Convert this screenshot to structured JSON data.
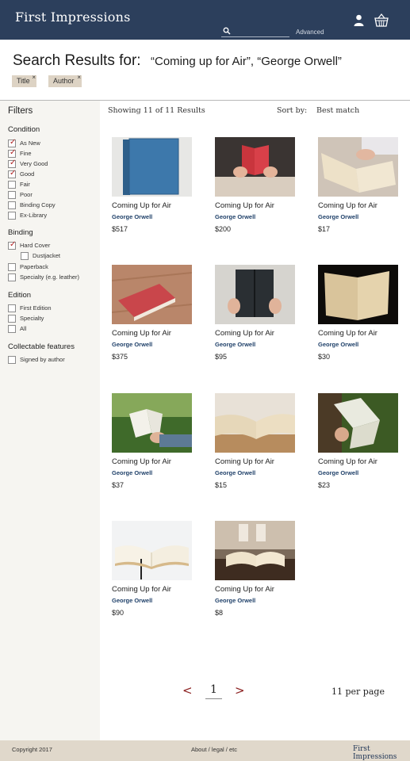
{
  "header": {
    "brand": "First Impressions",
    "search_placeholder": "",
    "advanced_label": "Advanced",
    "icons": [
      "search-icon",
      "user-icon",
      "basket-icon"
    ],
    "bg_color": "#2c3f5c"
  },
  "search": {
    "title": "Search Results for:",
    "query": "“Coming up for Air”, “George Orwell”",
    "chips": [
      {
        "label": "Title",
        "remove": "×"
      },
      {
        "label": "Author",
        "remove": "×"
      }
    ]
  },
  "filters": {
    "title": "Filters",
    "groups": [
      {
        "title": "Condition",
        "options": [
          {
            "label": "As New",
            "checked": true
          },
          {
            "label": "Fine",
            "checked": true
          },
          {
            "label": "Very Good",
            "checked": true
          },
          {
            "label": "Good",
            "checked": true
          },
          {
            "label": "Fair",
            "checked": false
          },
          {
            "label": "Poor",
            "checked": false
          },
          {
            "label": "Binding Copy",
            "checked": false
          },
          {
            "label": "Ex-Library",
            "checked": false
          }
        ]
      },
      {
        "title": "Binding",
        "options": [
          {
            "label": "Hard Cover",
            "checked": true
          },
          {
            "label": "Dustjacket",
            "checked": false
          },
          {
            "label": "Paperback",
            "checked": false
          },
          {
            "label": "Specialty (e.g. leather)",
            "checked": false
          }
        ]
      },
      {
        "title": "Edition",
        "options": [
          {
            "label": "First Edition",
            "checked": false
          },
          {
            "label": "Specialty",
            "checked": false
          },
          {
            "label": "All",
            "checked": false
          }
        ]
      },
      {
        "title": "Collectable features",
        "options": [
          {
            "label": "Signed by author",
            "checked": false
          }
        ]
      }
    ],
    "check_mark": "✓"
  },
  "results": {
    "showing": "Showing 11 of 11 Results",
    "sort_label": "Sort by:",
    "sort_value": "Best match",
    "items": [
      {
        "title": "Coming Up for Air",
        "author": "George Orwell",
        "price": "$517"
      },
      {
        "title": "Coming Up for Air",
        "author": "George Orwell",
        "price": "$200"
      },
      {
        "title": "Coming Up for Air",
        "author": "George Orwell",
        "price": "$17"
      },
      {
        "title": "Coming Up for Air",
        "author": "George Orwell",
        "price": "$375"
      },
      {
        "title": "Coming Up for Air",
        "author": "George Orwell",
        "price": "$95"
      },
      {
        "title": "Coming Up for Air",
        "author": "George Orwell",
        "price": "$30"
      },
      {
        "title": "Coming Up for Air",
        "author": "George Orwell",
        "price": "$37"
      },
      {
        "title": "Coming Up for Air",
        "author": "George Orwell",
        "price": "$15"
      },
      {
        "title": "Coming Up for Air",
        "author": "George Orwell",
        "price": "$23"
      },
      {
        "title": "Coming Up for Air",
        "author": "George Orwell",
        "price": "$90"
      },
      {
        "title": "Coming Up for Air",
        "author": "George Orwell",
        "price": "$8"
      }
    ]
  },
  "pagination": {
    "prev": "<",
    "page": "1",
    "next": ">",
    "per_page": "11 per page"
  },
  "footer": {
    "copyright": "Copyright 2017",
    "links": "About / legal / etc",
    "brand": "First Impressions"
  },
  "colors": {
    "accent": "#8b1f1f",
    "author_link": "#1f4069",
    "chip_bg": "#ddd3c4",
    "footer_bg": "#e0d8cb",
    "sidebar_bg": "#f6f5f1"
  }
}
